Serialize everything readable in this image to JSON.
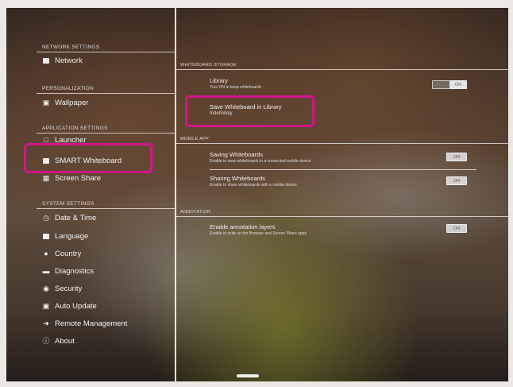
{
  "sidebar": {
    "sections": [
      {
        "header": "NETWORK SETTINGS",
        "items": [
          {
            "label": "Network",
            "icon": "network-icon"
          }
        ]
      },
      {
        "header": "PERSONALIZATION",
        "items": [
          {
            "label": "Wallpaper",
            "icon": "wallpaper-icon"
          }
        ]
      },
      {
        "header": "APPLICATION SETTINGS",
        "items": [
          {
            "label": "Launcher",
            "icon": "launcher-icon"
          },
          {
            "label": "SMART Whiteboard",
            "icon": "whiteboard-icon"
          },
          {
            "label": "Screen Share",
            "icon": "screen-share-icon"
          }
        ]
      },
      {
        "header": "SYSTEM SETTINGS",
        "items": [
          {
            "label": "Date & Time",
            "icon": "clock-icon"
          },
          {
            "label": "Language",
            "icon": "language-icon"
          },
          {
            "label": "Country",
            "icon": "location-icon"
          },
          {
            "label": "Diagnostics",
            "icon": "diagnostics-icon"
          },
          {
            "label": "Security",
            "icon": "security-icon"
          },
          {
            "label": "Auto Update",
            "icon": "update-icon"
          },
          {
            "label": "Remote Management",
            "icon": "remote-icon"
          },
          {
            "label": "About",
            "icon": "info-icon"
          }
        ]
      }
    ]
  },
  "main": {
    "whiteboard_storage": {
      "header": "WHITEBOARD STORAGE",
      "library": {
        "title": "Library",
        "desc": "Turn ON to keep whiteboards",
        "toggle": "ON"
      },
      "save": {
        "title": "Save Whiteboard in Library",
        "value": "Indefinitely"
      }
    },
    "mobile_app": {
      "header": "MOBILE APP",
      "saving": {
        "title": "Saving Whiteboards",
        "desc": "Enable to save whiteboards to a connected mobile device",
        "toggle": "ON"
      },
      "sharing": {
        "title": "Sharing Whiteboards",
        "desc": "Enable to share whiteboards with a mobile device",
        "toggle": "ON"
      }
    },
    "annotation": {
      "header": "ANNOTATION",
      "layers": {
        "title": "Enable annotation layers",
        "desc": "Enable to write on the Browser and Screen Share apps",
        "toggle": "ON"
      }
    }
  },
  "colors": {
    "highlight": "#d4148a"
  }
}
